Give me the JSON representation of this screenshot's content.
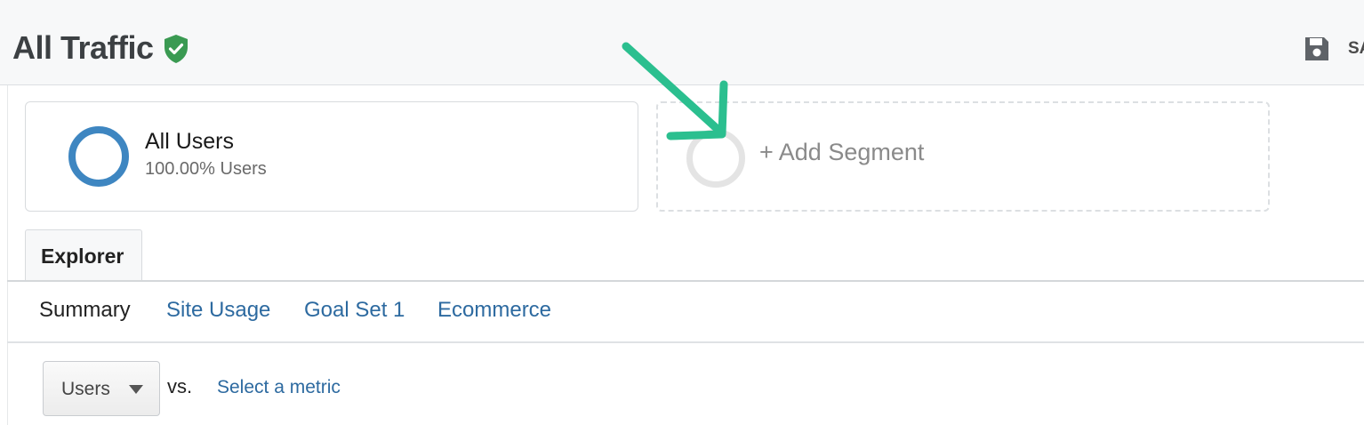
{
  "header": {
    "title": "All Traffic",
    "save_label": "SAVE"
  },
  "segments": {
    "active": {
      "name": "All Users",
      "sub": "100.00% Users",
      "ring_color": "#3e86c1"
    },
    "add_label": "+ Add Segment"
  },
  "annotation": {
    "arrow_color": "#2bbf8f"
  },
  "tabs": {
    "explorer_label": "Explorer",
    "subtabs": [
      "Summary",
      "Site Usage",
      "Goal Set 1",
      "Ecommerce"
    ],
    "active_subtab": "Summary"
  },
  "metric": {
    "selected": "Users",
    "vs_label": "vs.",
    "select_link": "Select a metric"
  },
  "colors": {
    "link": "#2d6aa0",
    "shield": "#3a9a52"
  }
}
